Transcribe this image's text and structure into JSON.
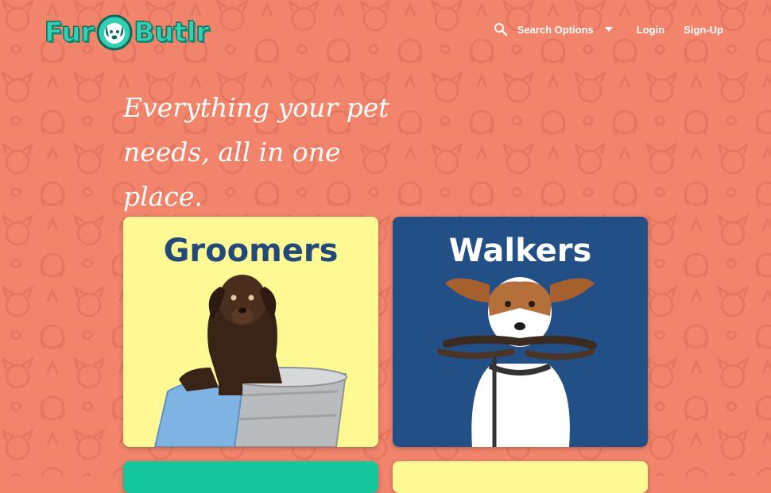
{
  "brand": {
    "name_left": "Fur",
    "name_right": "Butlr",
    "logo_icon": "dog-face-icon",
    "primary_color": "#32d0b0"
  },
  "nav": {
    "search_icon": "search-icon",
    "search_label": "Search Options",
    "dropdown_icon": "caret-down-icon",
    "login": "Login",
    "signup": "Sign-Up"
  },
  "hero": {
    "line1": "Everything your pet",
    "line2": "needs, all in one place."
  },
  "cards": [
    {
      "title": "Groomers",
      "image": "puppy-in-bucket",
      "color": "#fff993"
    },
    {
      "title": "Walkers",
      "image": "dog-with-leash",
      "color": "#224f85"
    },
    {
      "title": "",
      "color": "#14c79c"
    },
    {
      "title": "",
      "color": "#fff993"
    }
  ],
  "colors": {
    "background": "#f2846c",
    "title_dark_blue": "#23497a"
  }
}
